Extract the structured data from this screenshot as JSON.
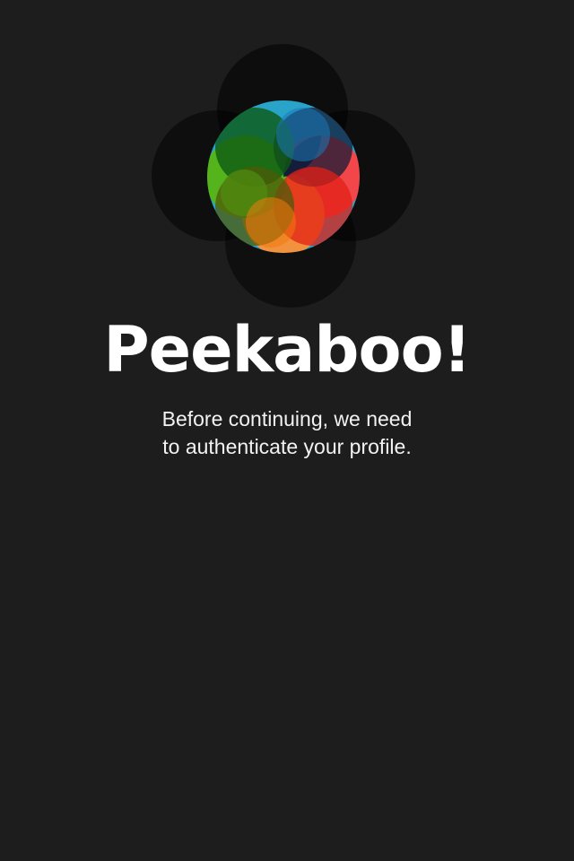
{
  "app": {
    "title": "Peekaboo!"
  },
  "message": {
    "line1": "Before continuing, we need",
    "line2": "to authenticate your profile."
  },
  "logo": {
    "icon": "peekaboo-logo-icon",
    "colors": {
      "blue": "#2aa3c9",
      "red": "#f2464a",
      "orange": "#f2923f",
      "green": "#55b41c",
      "background": "#1d1d1d"
    }
  }
}
